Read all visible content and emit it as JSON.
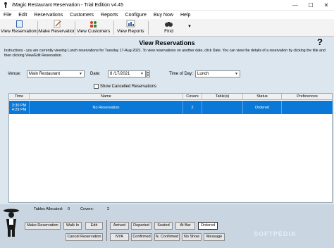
{
  "window": {
    "title": "/Magic Restaurant Reservation - Trial Edition v4.45"
  },
  "menu": [
    "File",
    "Edit",
    "Reservations",
    "Customers",
    "Reports",
    "Configure",
    "Buy Now",
    "Help"
  ],
  "toolbar": {
    "view_reservations": "View Reservations",
    "make_reservation": "Make Reservation",
    "view_customers": "View Customers",
    "view_reports": "View Reports",
    "find": "Find"
  },
  "panel": {
    "title": "View Reservations",
    "help": "?",
    "instructions": "Instructions - you are currently viewing Lunch reservations for Tuesday 17-Aug-2021. To view reservations on another date, click Date. You can view the details of a reservation by clicking the title and then clicking View/Edit Reservation."
  },
  "filters": {
    "venue_label": "Venue:",
    "venue_value": "Main Restaurant",
    "date_label": "Date:",
    "date_value": "8 /17/2021",
    "time_label": "Time of Day:",
    "time_value": "Lunch",
    "show_cancelled": "Show Cancelled Reservations"
  },
  "grid": {
    "columns": [
      "Time",
      "Name",
      "Covers",
      "Table(s)",
      "Status",
      "Preferences"
    ],
    "rows": [
      {
        "time_start": "3:30 PM",
        "time_end": "4:29 PM",
        "name": "No Reservation",
        "covers": "2",
        "tables": "",
        "status": "Ordered",
        "preferences": ""
      }
    ]
  },
  "stats": {
    "tables_label": "Tables Allocated:",
    "tables_value": "0",
    "covers_label": "Covers:",
    "covers_value": "2"
  },
  "actions": {
    "make_reservation": "Make Reservation",
    "walk_in": "Walk In",
    "edit": "Edit",
    "cancel_reservation": "Cancel Reservation"
  },
  "status_buttons": {
    "arrived": "Arrived",
    "departed": "Departed",
    "seated": "Seated",
    "at_bar": "At Bar",
    "ordered": "Ordered",
    "nya": "NYA",
    "confirmed": "Confirmed",
    "n_confirmed": "N. Confirmed",
    "no_show": "No Show",
    "message": "Message"
  },
  "watermark": "SOFTPEDIA",
  "colors": {
    "selected_row": "#0a78d7",
    "background": "#dbe6ef",
    "bottom_bar": "#c9d6e2"
  }
}
